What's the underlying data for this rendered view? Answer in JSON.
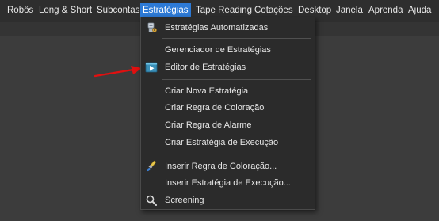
{
  "menubar": {
    "items": [
      {
        "label": "Robôs"
      },
      {
        "label": "Long & Short"
      },
      {
        "label": "Subcontas"
      },
      {
        "label": "Estratégias"
      },
      {
        "label": "Tape Reading"
      },
      {
        "label": "Cotações"
      },
      {
        "label": "Desktop"
      },
      {
        "label": "Janela"
      },
      {
        "label": "Aprenda"
      },
      {
        "label": "Ajuda"
      }
    ],
    "active_item": "Estratégias",
    "active_color": "#2d7ad6"
  },
  "dropdown": {
    "items": [
      {
        "label": "Estratégias Automatizadas",
        "icon": "robot-gear-icon"
      },
      {
        "label": "Gerenciador de Estratégias"
      },
      {
        "label": "Editor de Estratégias",
        "icon": "play-editor-icon"
      },
      {
        "label": "Criar Nova Estratégia"
      },
      {
        "label": "Criar Regra de Coloração"
      },
      {
        "label": "Criar Regra de Alarme"
      },
      {
        "label": "Criar Estratégia de Execução"
      },
      {
        "label": "Inserir Regra de Coloração...",
        "icon": "paint-brush-icon"
      },
      {
        "label": "Inserir Estratégia de Execução..."
      },
      {
        "label": "Screening",
        "icon": "magnifier-icon"
      }
    ]
  },
  "annotation": {
    "icon": "red-arrow-icon",
    "color": "#e01010"
  }
}
